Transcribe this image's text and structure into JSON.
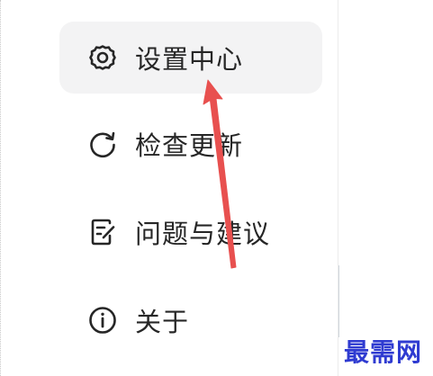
{
  "menu": {
    "items": [
      {
        "label": "设置中心",
        "icon": "gear-icon",
        "active": true
      },
      {
        "label": "检查更新",
        "icon": "refresh-icon",
        "active": false
      },
      {
        "label": "问题与建议",
        "icon": "feedback-edit-icon",
        "active": false
      },
      {
        "label": "关于",
        "icon": "info-icon",
        "active": false
      }
    ]
  },
  "annotation": {
    "arrow_color": "#e8504f",
    "points_to": "设置中心"
  },
  "watermark": {
    "text": "最需网",
    "color": "#2f3bd1"
  },
  "colors": {
    "active_background": "#f3f3f4",
    "text": "#262626",
    "icon_stroke": "#262626"
  }
}
